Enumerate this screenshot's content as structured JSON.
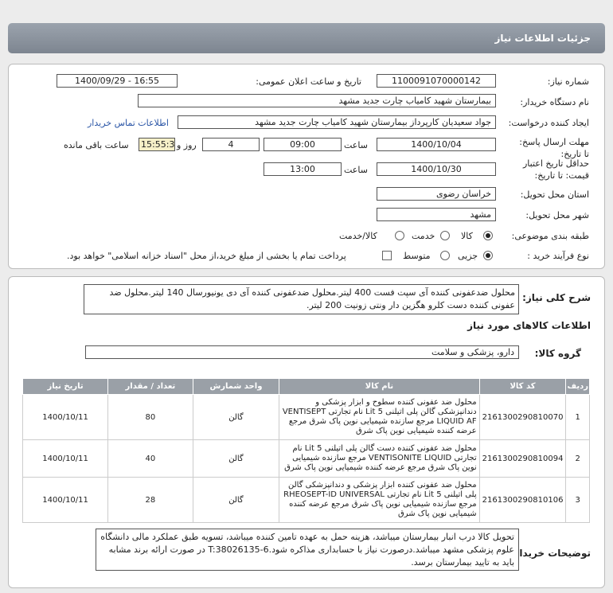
{
  "header": {
    "title": "جزئیات اطلاعات نیاز"
  },
  "fields": {
    "need_number_label": "شماره نیاز:",
    "need_number": "1100091070000142",
    "announce_label": "تاریخ و ساعت اعلان عمومی:",
    "announce_value": "1400/09/29 - 16:55",
    "buyer_label": "نام دستگاه خریدار:",
    "buyer_value": "بیمارستان شهید کامیاب چارت جدید مشهد",
    "creator_label": "ایجاد کننده درخواست:",
    "creator_value": "جواد سعیدیان کارپرداز بیمارستان شهید کامیاب چارت جدید مشهد",
    "contact_link": "اطلاعات تماس خریدار",
    "deadline_label": "مهلت ارسال پاسخ: تا تاریخ:",
    "deadline_date": "1400/10/04",
    "time_label": "ساعت",
    "deadline_time": "09:00",
    "days_value": "4",
    "days_label": "روز و",
    "remaining_time": "15:55:39",
    "remaining_label": "ساعت باقی مانده",
    "validity_label": "حداقل تاریخ اعتبار قیمت: تا تاریخ:",
    "validity_date": "1400/10/30",
    "validity_time": "13:00",
    "province_label": "استان محل تحویل:",
    "province_value": "خراسان رضوی",
    "city_label": "شهر محل تحویل:",
    "city_value": "مشهد",
    "category_label": "طبقه بندی موضوعی:",
    "category_options": [
      "کالا",
      "خدمت",
      "کالا/خدمت"
    ],
    "process_label": "نوع فرآیند خرید :",
    "process_options": [
      "جزیی",
      "متوسط"
    ],
    "payment_note": "پرداخت تمام یا بخشی از مبلغ خرید،از محل \"اسناد خزانه اسلامی\" خواهد بود."
  },
  "summary": {
    "label": "شرح کلی نیاز:",
    "text": "محلول ضدعفونی کننده آی سپت فست 400 لیتر.محلول ضدعفونی کننده آی دی یونیورسال 140 لیتر.محلول ضد عفونی کننده دست کلرو هگزین دار ونتی زونیت 200 لیتر."
  },
  "goods": {
    "section_title": "اطلاعات کالاهای مورد نیاز",
    "group_label": "گروه کالا:",
    "group_value": "دارو، پزشکی و سلامت",
    "columns": [
      "ردیف",
      "کد کالا",
      "نام کالا",
      "واحد شمارش",
      "تعداد / مقدار",
      "تاریخ نیاز"
    ],
    "rows": [
      {
        "idx": "1",
        "code": "2161300290810070",
        "name": "محلول ضد عفونی کننده سطوح و ابزار پزشکی و دندانپزشکی گالن پلی اتیلنی 5 Lit نام تجارتی VENTISEPT LIQUID AF مرجع سازنده شیمیایی نوین پاک شرق مرجع عرضه کننده شیمیایی نوین پاک شرق",
        "unit": "گالن",
        "qty": "80",
        "date": "1400/10/11"
      },
      {
        "idx": "2",
        "code": "2161300290810094",
        "name": "محلول ضد عفونی کننده دست گالن پلی اتیلنی 5 Lit نام تجارتی VENTISONITE LIQUID مرجع سازنده شیمیایی نوین پاک شرق مرجع عرضه کننده شیمیایی نوین پاک شرق",
        "unit": "گالن",
        "qty": "40",
        "date": "1400/10/11"
      },
      {
        "idx": "3",
        "code": "2161300290810106",
        "name": "محلول ضد عفونی کننده ابزار پزشکی و دندانپزشکی گالن پلی اتیلنی 5 Lit نام تجارتی RHEOSEPT-ID UNIVERSAL مرجع سازنده شیمیایی نوین پاک شرق مرجع عرضه کننده شیمیایی نوین پاک شرق",
        "unit": "گالن",
        "qty": "28",
        "date": "1400/10/11"
      }
    ]
  },
  "notes": {
    "label": "توضیحات خریدار:",
    "text": "تحویل کالا درب انبار بیمارستان میباشد، هزینه حمل به عهده تامین کننده میباشد، تسویه طبق عملکرد مالی دانشگاه علوم پزشکی مشهد میباشد.درصورت نیاز با حسابداری مذاکره شود.T:38026135-6 در صورت ارائه برند مشابه باید به تایید بیمارستان برسد."
  }
}
